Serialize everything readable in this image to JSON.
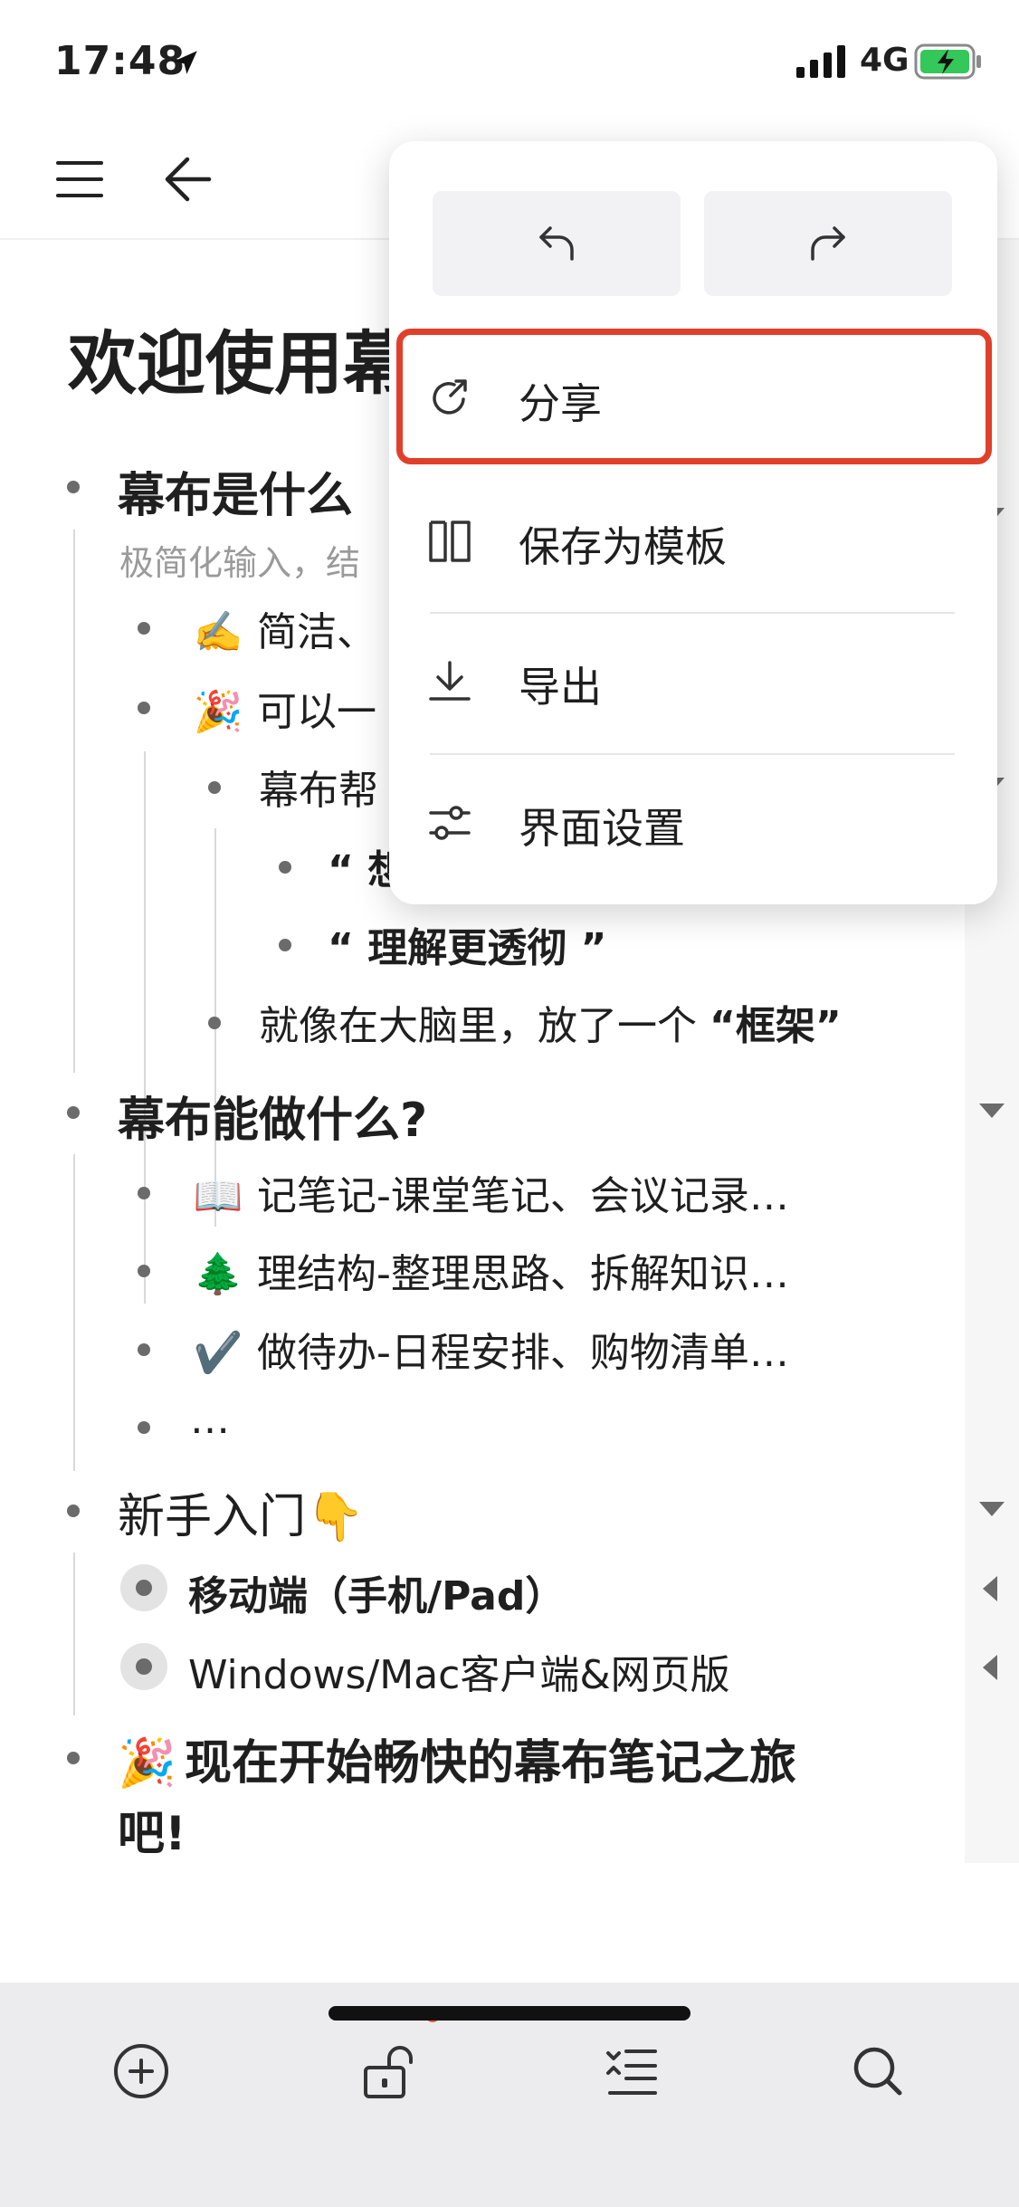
{
  "status_bar": {
    "time": "17:48",
    "network": "4G",
    "icons": [
      "location-arrow-icon",
      "signal-icon",
      "battery-charging-icon"
    ]
  },
  "header": {
    "icons": [
      "menu-icon",
      "back-arrow-icon"
    ]
  },
  "document": {
    "title": "欢迎使用幕",
    "sections": {
      "what": {
        "heading": "幕布是什么",
        "note": "极简化输入，结",
        "item1": {
          "emoji": "✍️",
          "text": "简洁、"
        },
        "item2": {
          "emoji": "🎉",
          "text": "可以一"
        },
        "sub1": "幕布帮",
        "sub1_a": "“ 想",
        "sub1_b": "“ 理解更透彻 ”",
        "sub2_prefix": "就像在大脑里，放了一个 ",
        "sub2_bold": "“框架”"
      },
      "can_do": {
        "heading": "幕布能做什么?",
        "items": [
          {
            "emoji": "📖",
            "text": "记笔记-课堂笔记、会议记录…"
          },
          {
            "emoji": "🌲",
            "text": "理结构-整理思路、拆解知识…"
          },
          {
            "emoji": "✔️",
            "text": "做待办-日程安排、购物清单…"
          },
          {
            "emoji": "",
            "text": "…"
          }
        ]
      },
      "getting_started": {
        "heading": "新手入门",
        "heading_emoji": "👇",
        "items": [
          "移动端（手机/Pad）",
          "Windows/Mac客户端&网页版"
        ]
      },
      "closing": {
        "emoji": "🎉",
        "line1": "现在开始畅快的幕布笔记之旅",
        "line2": "吧!"
      }
    }
  },
  "popup_menu": {
    "undo_icon": "undo-icon",
    "redo_icon": "redo-icon",
    "items": [
      {
        "label": "分享",
        "icon": "share-icon",
        "highlighted": true
      },
      {
        "label": "保存为模板",
        "icon": "template-icon"
      },
      {
        "label": "导出",
        "icon": "download-icon"
      },
      {
        "label": "界面设置",
        "icon": "sliders-icon"
      }
    ],
    "highlight_color": "#e0402a"
  },
  "toolbar": {
    "icons": [
      "add-circle-icon",
      "unlock-icon",
      "indent-outdent-icon",
      "search-icon"
    ],
    "badge_color": "#ff5a45"
  }
}
